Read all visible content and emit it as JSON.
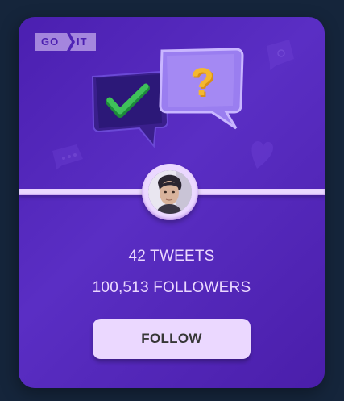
{
  "logo": {
    "left_text": "GO",
    "right_text": "IT"
  },
  "profile": {
    "tweets": "42 TWEETS",
    "followers": "100,513 FOLLOWERS"
  },
  "actions": {
    "follow_label": "FOLLOW"
  },
  "colors": {
    "background": "#15253b",
    "card_gradient_start": "#4b1fb0",
    "card_gradient_end": "#5a2ec4",
    "accent_light": "#ebd8ff",
    "button_text": "#373737",
    "check_green": "#3fc05a",
    "question_yellow": "#f5b82e"
  },
  "icons": {
    "check_bubble": "check-bubble-icon",
    "question_bubble": "question-bubble-icon"
  }
}
